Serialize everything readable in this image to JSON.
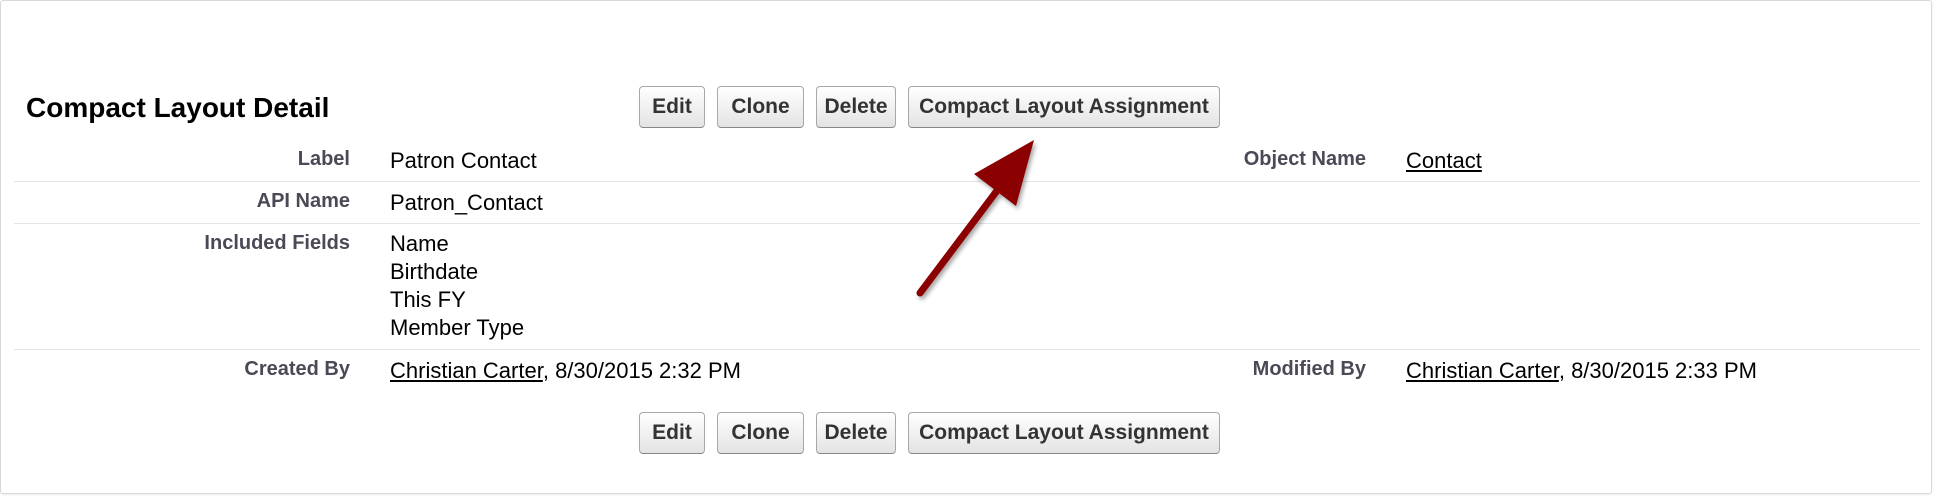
{
  "page": {
    "title": "Compact Layout Detail"
  },
  "buttons": {
    "edit": "Edit",
    "clone": "Clone",
    "delete": "Delete",
    "assignment": "Compact Layout Assignment"
  },
  "fields": {
    "label": {
      "name": "Label",
      "value": "Patron Contact"
    },
    "object_name": {
      "name": "Object Name",
      "value": "Contact"
    },
    "api_name": {
      "name": "API Name",
      "value": "Patron_Contact"
    },
    "included_fields": {
      "name": "Included Fields",
      "values": [
        "Name",
        "Birthdate",
        "This FY",
        "Member Type"
      ]
    },
    "created_by": {
      "name": "Created By",
      "user": "Christian Carter",
      "date": ", 8/30/2015 2:32 PM"
    },
    "modified_by": {
      "name": "Modified By",
      "user": "Christian Carter",
      "date": ", 8/30/2015 2:33 PM"
    }
  },
  "annotation": {
    "arrow_color": "#8b0000",
    "arrow_icon": "red-arrow-icon"
  }
}
